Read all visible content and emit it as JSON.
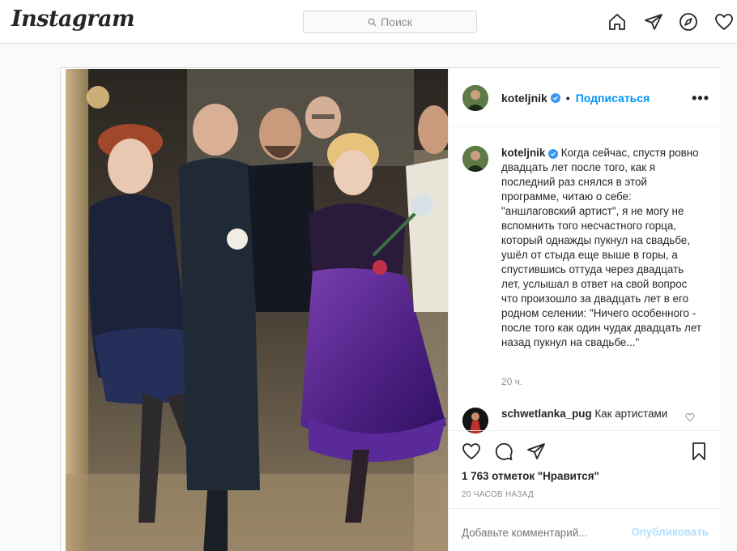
{
  "header": {
    "logo": "Instagram",
    "search_placeholder": "Поиск"
  },
  "post": {
    "author": "koteljnik",
    "follow_label": "Подписаться",
    "dot": "•",
    "more_label": "•••",
    "caption_user": "koteljnik",
    "caption_text": "Когда сейчас, спустя ровно двадцать лет после того, как я последний раз снялся в этой программе, читаю о себе: \"аншлаговский артист\", я не могу не вспомнить того несчастного горца, который однажды пукнул на свадьбе, ушёл от стыда еще выше в горы, а спустившись оттуда через двадцать лет, услышал в ответ на свой вопрос что произошло за двадцать лет в его родном селении: \"Ничего особенного - после того как один чудак двадцать лет назад пукнул на свадьбе...\"",
    "caption_time": "20 ч.",
    "comment_user": "schwetlanka_pug",
    "comment_text": "Как артистами",
    "likes": "1 763 отметок \"Нравится\"",
    "time_ago": "20 ЧАСОВ НАЗАД",
    "add_comment_placeholder": "Добавьте комментарий...",
    "publish_label": "Опубликовать"
  },
  "icons": {
    "home": "home-icon",
    "direct": "paper-plane-icon",
    "explore": "compass-icon",
    "activity": "heart-icon",
    "like": "heart-icon",
    "comment": "comment-icon",
    "share": "paper-plane-icon",
    "save": "bookmark-icon",
    "verified": "verified-badge-icon"
  },
  "colors": {
    "accent": "#0095f6",
    "verified": "#3897f0",
    "publish_disabled": "#b2dffc",
    "border": "#dbdbdb"
  }
}
